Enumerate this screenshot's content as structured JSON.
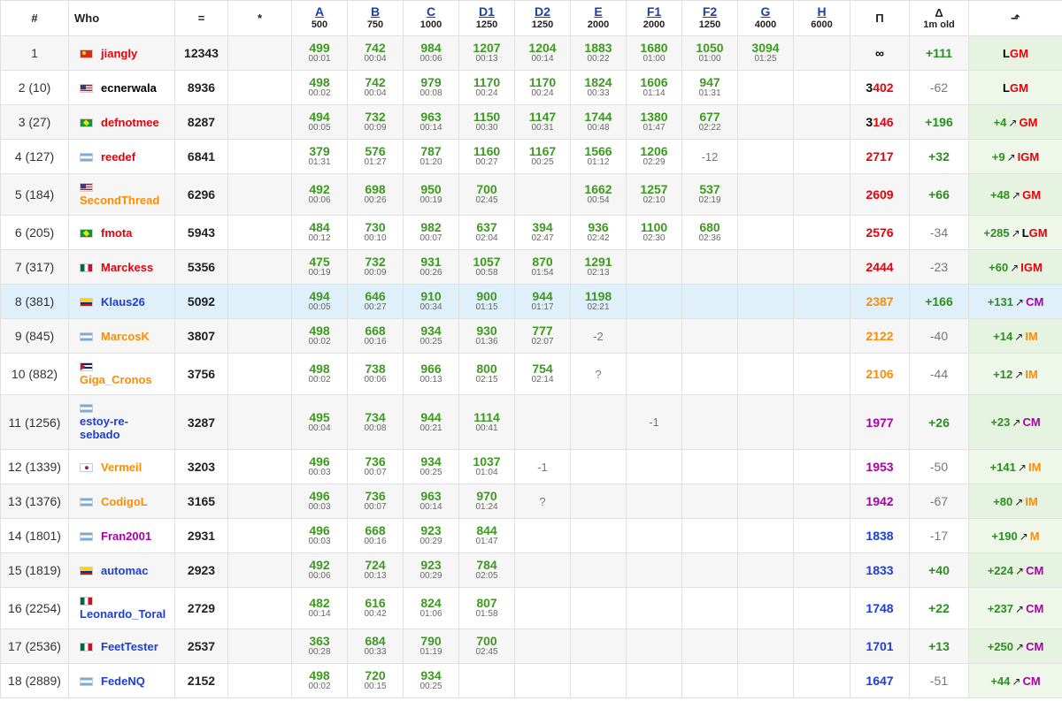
{
  "headers": {
    "rank": "#",
    "who": "Who",
    "score": "=",
    "hacks": "*",
    "perf": "Π",
    "delta": "Δ",
    "delta_sub": "1m old",
    "title": "⬏"
  },
  "problems": [
    {
      "label": "A",
      "points": "500"
    },
    {
      "label": "B",
      "points": "750"
    },
    {
      "label": "C",
      "points": "1000"
    },
    {
      "label": "D1",
      "points": "1250"
    },
    {
      "label": "D2",
      "points": "1250"
    },
    {
      "label": "E",
      "points": "2000"
    },
    {
      "label": "F1",
      "points": "2000"
    },
    {
      "label": "F2",
      "points": "1250"
    },
    {
      "label": "G",
      "points": "4000"
    },
    {
      "label": "H",
      "points": "6000"
    }
  ],
  "colors": {
    "legendary": "#e8000a",
    "red": "#e8000a",
    "orange": "#ff8c00",
    "violet": "#aa00aa",
    "blue": "#1d3ed6",
    "accepted": "#3c9a1f",
    "highlight_row": "#dff0fa"
  },
  "rows": [
    {
      "rank": "1",
      "flag": "cn",
      "handle": "jiangly",
      "handle_color": "red",
      "score": "12343",
      "cells": [
        [
          "499",
          "00:01"
        ],
        [
          "742",
          "00:04"
        ],
        [
          "984",
          "00:06"
        ],
        [
          "1207",
          "00:13"
        ],
        [
          "1204",
          "00:14"
        ],
        [
          "1883",
          "00:22"
        ],
        [
          "1680",
          "01:00"
        ],
        [
          "1050",
          "01:00"
        ],
        [
          "3094",
          "01:25"
        ],
        null
      ],
      "perf": "∞",
      "perf_color": "black",
      "delta": "+111",
      "title_inc": "",
      "title_first": "L",
      "title_rest": "GM",
      "title_color": "red"
    },
    {
      "rank": "2 (10)",
      "flag": "us",
      "handle": "ecnerwala",
      "handle_color": "black",
      "score": "8936",
      "cells": [
        [
          "498",
          "00:02"
        ],
        [
          "742",
          "00:04"
        ],
        [
          "979",
          "00:08"
        ],
        [
          "1170",
          "00:24"
        ],
        [
          "1170",
          "00:24"
        ],
        [
          "1824",
          "00:33"
        ],
        [
          "1606",
          "01:14"
        ],
        [
          "947",
          "01:31"
        ],
        null,
        null
      ],
      "perf": "3402",
      "perf_first": "3",
      "perf_rest": "402",
      "perf_color": "red",
      "delta": "-62",
      "title_inc": "",
      "title_first": "L",
      "title_rest": "GM",
      "title_color": "red"
    },
    {
      "rank": "3 (27)",
      "flag": "br",
      "handle": "defnotmee",
      "handle_color": "red",
      "score": "8287",
      "cells": [
        [
          "494",
          "00:05"
        ],
        [
          "732",
          "00:09"
        ],
        [
          "963",
          "00:14"
        ],
        [
          "1150",
          "00:30"
        ],
        [
          "1147",
          "00:31"
        ],
        [
          "1744",
          "00:48"
        ],
        [
          "1380",
          "01:47"
        ],
        [
          "677",
          "02:22"
        ],
        null,
        null
      ],
      "perf": "3146",
      "perf_first": "3",
      "perf_rest": "146",
      "perf_color": "red",
      "delta": "+196",
      "title_inc": "+4",
      "title_first": "",
      "title_rest": "GM",
      "title_color": "red"
    },
    {
      "rank": "4 (127)",
      "flag": "ar",
      "handle": "reedef",
      "handle_color": "red",
      "score": "6841",
      "cells": [
        [
          "379",
          "01:31"
        ],
        [
          "576",
          "01:27"
        ],
        [
          "787",
          "01:20"
        ],
        [
          "1160",
          "00:27"
        ],
        [
          "1167",
          "00:25"
        ],
        [
          "1566",
          "01:12"
        ],
        [
          "1206",
          "02:29"
        ],
        [
          "-12",
          ""
        ],
        null,
        null
      ],
      "perf": "2717",
      "perf_color": "red",
      "delta": "+32",
      "title_inc": "+9",
      "title_first": "",
      "title_rest": "IGM",
      "title_color": "red"
    },
    {
      "rank": "5 (184)",
      "flag": "us",
      "handle": "SecondThread",
      "handle_color": "orange",
      "score": "6296",
      "cells": [
        [
          "492",
          "00:06"
        ],
        [
          "698",
          "00:26"
        ],
        [
          "950",
          "00:19"
        ],
        [
          "700",
          "02:45"
        ],
        null,
        [
          "1662",
          "00:54"
        ],
        [
          "1257",
          "02:10"
        ],
        [
          "537",
          "02:19"
        ],
        null,
        null
      ],
      "perf": "2609",
      "perf_color": "red",
      "delta": "+66",
      "title_inc": "+48",
      "title_first": "",
      "title_rest": "GM",
      "title_color": "red"
    },
    {
      "rank": "6 (205)",
      "flag": "br",
      "handle": "fmota",
      "handle_color": "red",
      "score": "5943",
      "cells": [
        [
          "484",
          "00:12"
        ],
        [
          "730",
          "00:10"
        ],
        [
          "982",
          "00:07"
        ],
        [
          "637",
          "02:04"
        ],
        [
          "394",
          "02:47"
        ],
        [
          "936",
          "02:42"
        ],
        [
          "1100",
          "02:30"
        ],
        [
          "680",
          "02:36"
        ],
        null,
        null
      ],
      "perf": "2576",
      "perf_color": "red",
      "delta": "-34",
      "title_inc": "+285",
      "title_first": "L",
      "title_rest": "GM",
      "title_color": "red"
    },
    {
      "rank": "7 (317)",
      "flag": "mx",
      "handle": "Marckess",
      "handle_color": "red",
      "score": "5356",
      "cells": [
        [
          "475",
          "00:19"
        ],
        [
          "732",
          "00:09"
        ],
        [
          "931",
          "00:26"
        ],
        [
          "1057",
          "00:58"
        ],
        [
          "870",
          "01:54"
        ],
        [
          "1291",
          "02:13"
        ],
        null,
        null,
        null,
        null
      ],
      "perf": "2444",
      "perf_color": "red",
      "delta": "-23",
      "title_inc": "+60",
      "title_first": "",
      "title_rest": "IGM",
      "title_color": "red"
    },
    {
      "rank": "8 (381)",
      "flag": "co",
      "handle": "Klaus26",
      "handle_color": "blue",
      "score": "5092",
      "cells": [
        [
          "494",
          "00:05"
        ],
        [
          "646",
          "00:27"
        ],
        [
          "910",
          "00:34"
        ],
        [
          "900",
          "01:15"
        ],
        [
          "944",
          "01:17"
        ],
        [
          "1198",
          "02:21"
        ],
        null,
        null,
        null,
        null
      ],
      "perf": "2387",
      "perf_color": "orange",
      "delta": "+166",
      "title_inc": "+131",
      "title_first": "",
      "title_rest": "CM",
      "title_color": "violet"
    },
    {
      "rank": "9 (845)",
      "flag": "ar",
      "handle": "MarcosK",
      "handle_color": "orange",
      "score": "3807",
      "cells": [
        [
          "498",
          "00:02"
        ],
        [
          "668",
          "00:16"
        ],
        [
          "934",
          "00:25"
        ],
        [
          "930",
          "01:36"
        ],
        [
          "777",
          "02:07"
        ],
        [
          "-2",
          ""
        ],
        null,
        null,
        null,
        null
      ],
      "perf": "2122",
      "perf_color": "orange",
      "delta": "-40",
      "title_inc": "+14",
      "title_first": "",
      "title_rest": "IM",
      "title_color": "orange"
    },
    {
      "rank": "10 (882)",
      "flag": "cu",
      "handle": "Giga_Cronos",
      "handle_color": "orange",
      "score": "3756",
      "cells": [
        [
          "498",
          "00:02"
        ],
        [
          "738",
          "00:06"
        ],
        [
          "966",
          "00:13"
        ],
        [
          "800",
          "02:15"
        ],
        [
          "754",
          "02:14"
        ],
        [
          "?",
          ""
        ],
        null,
        null,
        null,
        null
      ],
      "perf": "2106",
      "perf_color": "orange",
      "delta": "-44",
      "title_inc": "+12",
      "title_first": "",
      "title_rest": "IM",
      "title_color": "orange"
    },
    {
      "rank": "11 (1256)",
      "flag": "ar",
      "handle": "estoy-re-sebado",
      "handle_line1": "estoy-re-",
      "handle_line2": "sebado",
      "handle_color": "blue",
      "score": "3287",
      "cells": [
        [
          "495",
          "00:04"
        ],
        [
          "734",
          "00:08"
        ],
        [
          "944",
          "00:21"
        ],
        [
          "1114",
          "00:41"
        ],
        null,
        null,
        [
          "-1",
          ""
        ],
        null,
        null,
        null
      ],
      "perf": "1977",
      "perf_color": "violet",
      "delta": "+26",
      "title_inc": "+23",
      "title_first": "",
      "title_rest": "CM",
      "title_color": "violet"
    },
    {
      "rank": "12 (1339)",
      "flag": "kr",
      "handle": "Vermeil",
      "handle_color": "orange",
      "score": "3203",
      "cells": [
        [
          "496",
          "00:03"
        ],
        [
          "736",
          "00:07"
        ],
        [
          "934",
          "00:25"
        ],
        [
          "1037",
          "01:04"
        ],
        [
          "-1",
          ""
        ],
        null,
        null,
        null,
        null,
        null
      ],
      "perf": "1953",
      "perf_color": "violet",
      "delta": "-50",
      "title_inc": "+141",
      "title_first": "",
      "title_rest": "IM",
      "title_color": "orange"
    },
    {
      "rank": "13 (1376)",
      "flag": "ar",
      "handle": "CodigoL",
      "handle_color": "orange",
      "score": "3165",
      "cells": [
        [
          "496",
          "00:03"
        ],
        [
          "736",
          "00:07"
        ],
        [
          "963",
          "00:14"
        ],
        [
          "970",
          "01:24"
        ],
        [
          "?",
          ""
        ],
        null,
        null,
        null,
        null,
        null
      ],
      "perf": "1942",
      "perf_color": "violet",
      "delta": "-67",
      "title_inc": "+80",
      "title_first": "",
      "title_rest": "IM",
      "title_color": "orange"
    },
    {
      "rank": "14 (1801)",
      "flag": "ar",
      "handle": "Fran2001",
      "handle_color": "violet",
      "score": "2931",
      "cells": [
        [
          "496",
          "00:03"
        ],
        [
          "668",
          "00:16"
        ],
        [
          "923",
          "00:29"
        ],
        [
          "844",
          "01:47"
        ],
        null,
        null,
        null,
        null,
        null,
        null
      ],
      "perf": "1838",
      "perf_color": "blue",
      "delta": "-17",
      "title_inc": "+190",
      "title_first": "",
      "title_rest": "M",
      "title_color": "orange"
    },
    {
      "rank": "15 (1819)",
      "flag": "co",
      "handle": "automac",
      "handle_color": "blue",
      "score": "2923",
      "cells": [
        [
          "492",
          "00:06"
        ],
        [
          "724",
          "00:13"
        ],
        [
          "923",
          "00:29"
        ],
        [
          "784",
          "02:05"
        ],
        null,
        null,
        null,
        null,
        null,
        null
      ],
      "perf": "1833",
      "perf_color": "blue",
      "delta": "+40",
      "title_inc": "+224",
      "title_first": "",
      "title_rest": "CM",
      "title_color": "violet"
    },
    {
      "rank": "16 (2254)",
      "flag": "mx",
      "handle": "Leonardo_Toral",
      "handle_color": "blue",
      "score": "2729",
      "cells": [
        [
          "482",
          "00:14"
        ],
        [
          "616",
          "00:42"
        ],
        [
          "824",
          "01:06"
        ],
        [
          "807",
          "01:58"
        ],
        null,
        null,
        null,
        null,
        null,
        null
      ],
      "perf": "1748",
      "perf_color": "blue",
      "delta": "+22",
      "title_inc": "+237",
      "title_first": "",
      "title_rest": "CM",
      "title_color": "violet"
    },
    {
      "rank": "17 (2536)",
      "flag": "mx",
      "handle": "FeetTester",
      "handle_color": "blue",
      "score": "2537",
      "cells": [
        [
          "363",
          "00:28"
        ],
        [
          "684",
          "00:33"
        ],
        [
          "790",
          "01:19"
        ],
        [
          "700",
          "02:45"
        ],
        null,
        null,
        null,
        null,
        null,
        null
      ],
      "perf": "1701",
      "perf_color": "blue",
      "delta": "+13",
      "title_inc": "+250",
      "title_first": "",
      "title_rest": "CM",
      "title_color": "violet"
    },
    {
      "rank": "18 (2889)",
      "flag": "ar",
      "handle": "FedeNQ",
      "handle_color": "blue",
      "score": "2152",
      "cells": [
        [
          "498",
          "00:02"
        ],
        [
          "720",
          "00:15"
        ],
        [
          "934",
          "00:25"
        ],
        null,
        null,
        null,
        null,
        null,
        null,
        null
      ],
      "perf": "1647",
      "perf_color": "blue",
      "delta": "-51",
      "title_inc": "+44",
      "title_first": "",
      "title_rest": "CM",
      "title_color": "violet"
    }
  ]
}
